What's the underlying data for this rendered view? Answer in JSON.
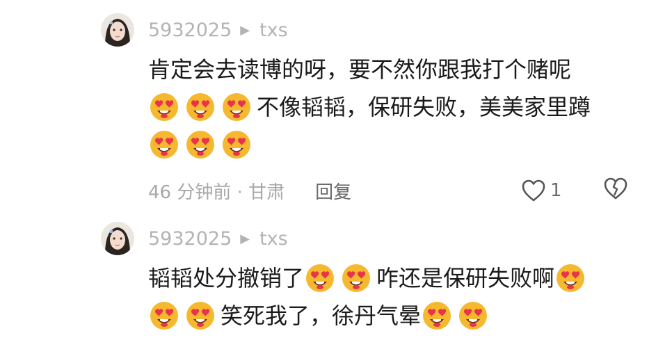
{
  "comments": [
    {
      "username": "5932025",
      "reply_to": "txs",
      "lines": [
        [
          {
            "t": "text",
            "v": "肯定会去读博的呀，要不然你跟我打个赌呢"
          }
        ],
        [
          {
            "t": "emoji"
          },
          {
            "t": "emoji"
          },
          {
            "t": "emoji"
          },
          {
            "t": "text",
            "v": "不像韬韬，保研失败，美美家里蹲"
          }
        ],
        [
          {
            "t": "emoji"
          },
          {
            "t": "emoji"
          },
          {
            "t": "emoji"
          }
        ]
      ],
      "time_location": "46 分钟前 · 甘肃",
      "reply_label": "回复",
      "like_count": "1"
    },
    {
      "username": "5932025",
      "reply_to": "txs",
      "lines": [
        [
          {
            "t": "text",
            "v": "韬韬处分撤销了"
          },
          {
            "t": "emoji"
          },
          {
            "t": "emoji"
          },
          {
            "t": "text",
            "v": "咋还是保研失败啊"
          },
          {
            "t": "emoji"
          }
        ],
        [
          {
            "t": "emoji"
          },
          {
            "t": "emoji"
          },
          {
            "t": "text",
            "v": "笑死我了，徐丹气晕"
          },
          {
            "t": "emoji"
          },
          {
            "t": "emoji"
          }
        ]
      ]
    }
  ],
  "icons": {
    "reply_arrow": "triangle-right-icon",
    "emoji": "smiling-face-with-heart-eyes-icon",
    "like": "heart-outline-icon",
    "dislike": "broken-heart-icon"
  },
  "colors": {
    "username": "#b3b3b3",
    "text": "#1a1a1a",
    "meta": "#a8a8a8",
    "emoji_face": "#f5b82e",
    "emoji_heart": "#e8334a"
  }
}
